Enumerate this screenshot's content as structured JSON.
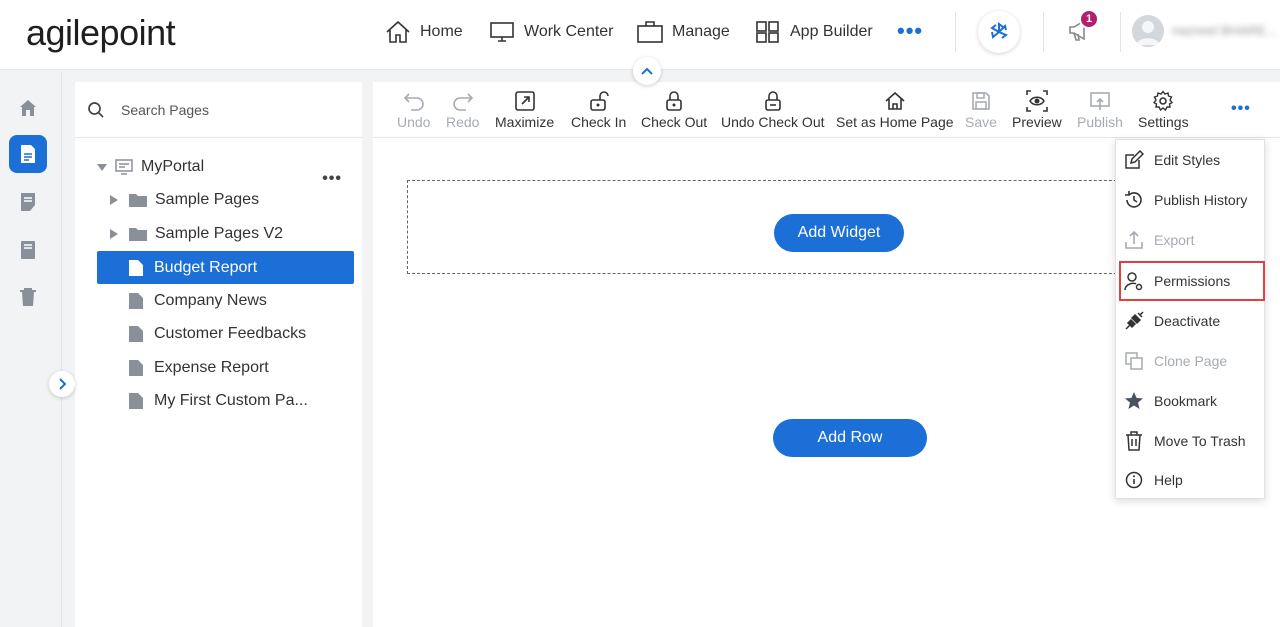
{
  "brand": {
    "logo_text": "agilepoint"
  },
  "topnav": {
    "items": [
      {
        "label": "Home",
        "icon": "home-icon"
      },
      {
        "label": "Work Center",
        "icon": "monitor-icon"
      },
      {
        "label": "Manage",
        "icon": "briefcase-icon"
      },
      {
        "label": "App Builder",
        "icon": "grid-icon"
      }
    ],
    "more_label": "•••",
    "notification_count": "1",
    "user_name": "nazneel BHARE..."
  },
  "tree": {
    "search_placeholder": "Search Pages",
    "root_label": "MyPortal",
    "more_label": "•••",
    "items": [
      {
        "label": "Sample Pages",
        "type": "folder"
      },
      {
        "label": "Sample Pages V2",
        "type": "folder"
      },
      {
        "label": "Budget Report",
        "type": "page",
        "selected": true
      },
      {
        "label": "Company News",
        "type": "page"
      },
      {
        "label": "Customer Feedbacks",
        "type": "page"
      },
      {
        "label": "Expense Report",
        "type": "page"
      },
      {
        "label": "My First Custom Pa...",
        "type": "page"
      }
    ]
  },
  "toolbar": {
    "undo": "Undo",
    "redo": "Redo",
    "maximize": "Maximize",
    "check_in": "Check In",
    "check_out": "Check Out",
    "undo_check_out": "Undo Check Out",
    "set_home": "Set as Home Page",
    "save": "Save",
    "preview": "Preview",
    "publish": "Publish",
    "settings": "Settings",
    "more_label": "•••"
  },
  "canvas": {
    "add_widget": "Add Widget",
    "add_row": "Add Row"
  },
  "menu": {
    "items": [
      {
        "label": "Edit Styles",
        "icon": "edit-icon",
        "disabled": false
      },
      {
        "label": "Publish History",
        "icon": "history-icon",
        "disabled": false
      },
      {
        "label": "Export",
        "icon": "export-icon",
        "disabled": true
      },
      {
        "label": "Permissions",
        "icon": "user-settings-icon",
        "disabled": false,
        "highlighted": true
      },
      {
        "label": "Deactivate",
        "icon": "unplug-icon",
        "disabled": false
      },
      {
        "label": "Clone Page",
        "icon": "clone-icon",
        "disabled": true
      },
      {
        "label": "Bookmark",
        "icon": "star-icon",
        "disabled": false
      },
      {
        "label": "Move To Trash",
        "icon": "trash-icon",
        "disabled": false
      },
      {
        "label": "Help",
        "icon": "info-icon",
        "disabled": false
      }
    ]
  },
  "colors": {
    "accent": "#1b6fd6",
    "highlight_border": "#e04040",
    "badge": "#b0206c",
    "disabled": "#a6abb3"
  }
}
